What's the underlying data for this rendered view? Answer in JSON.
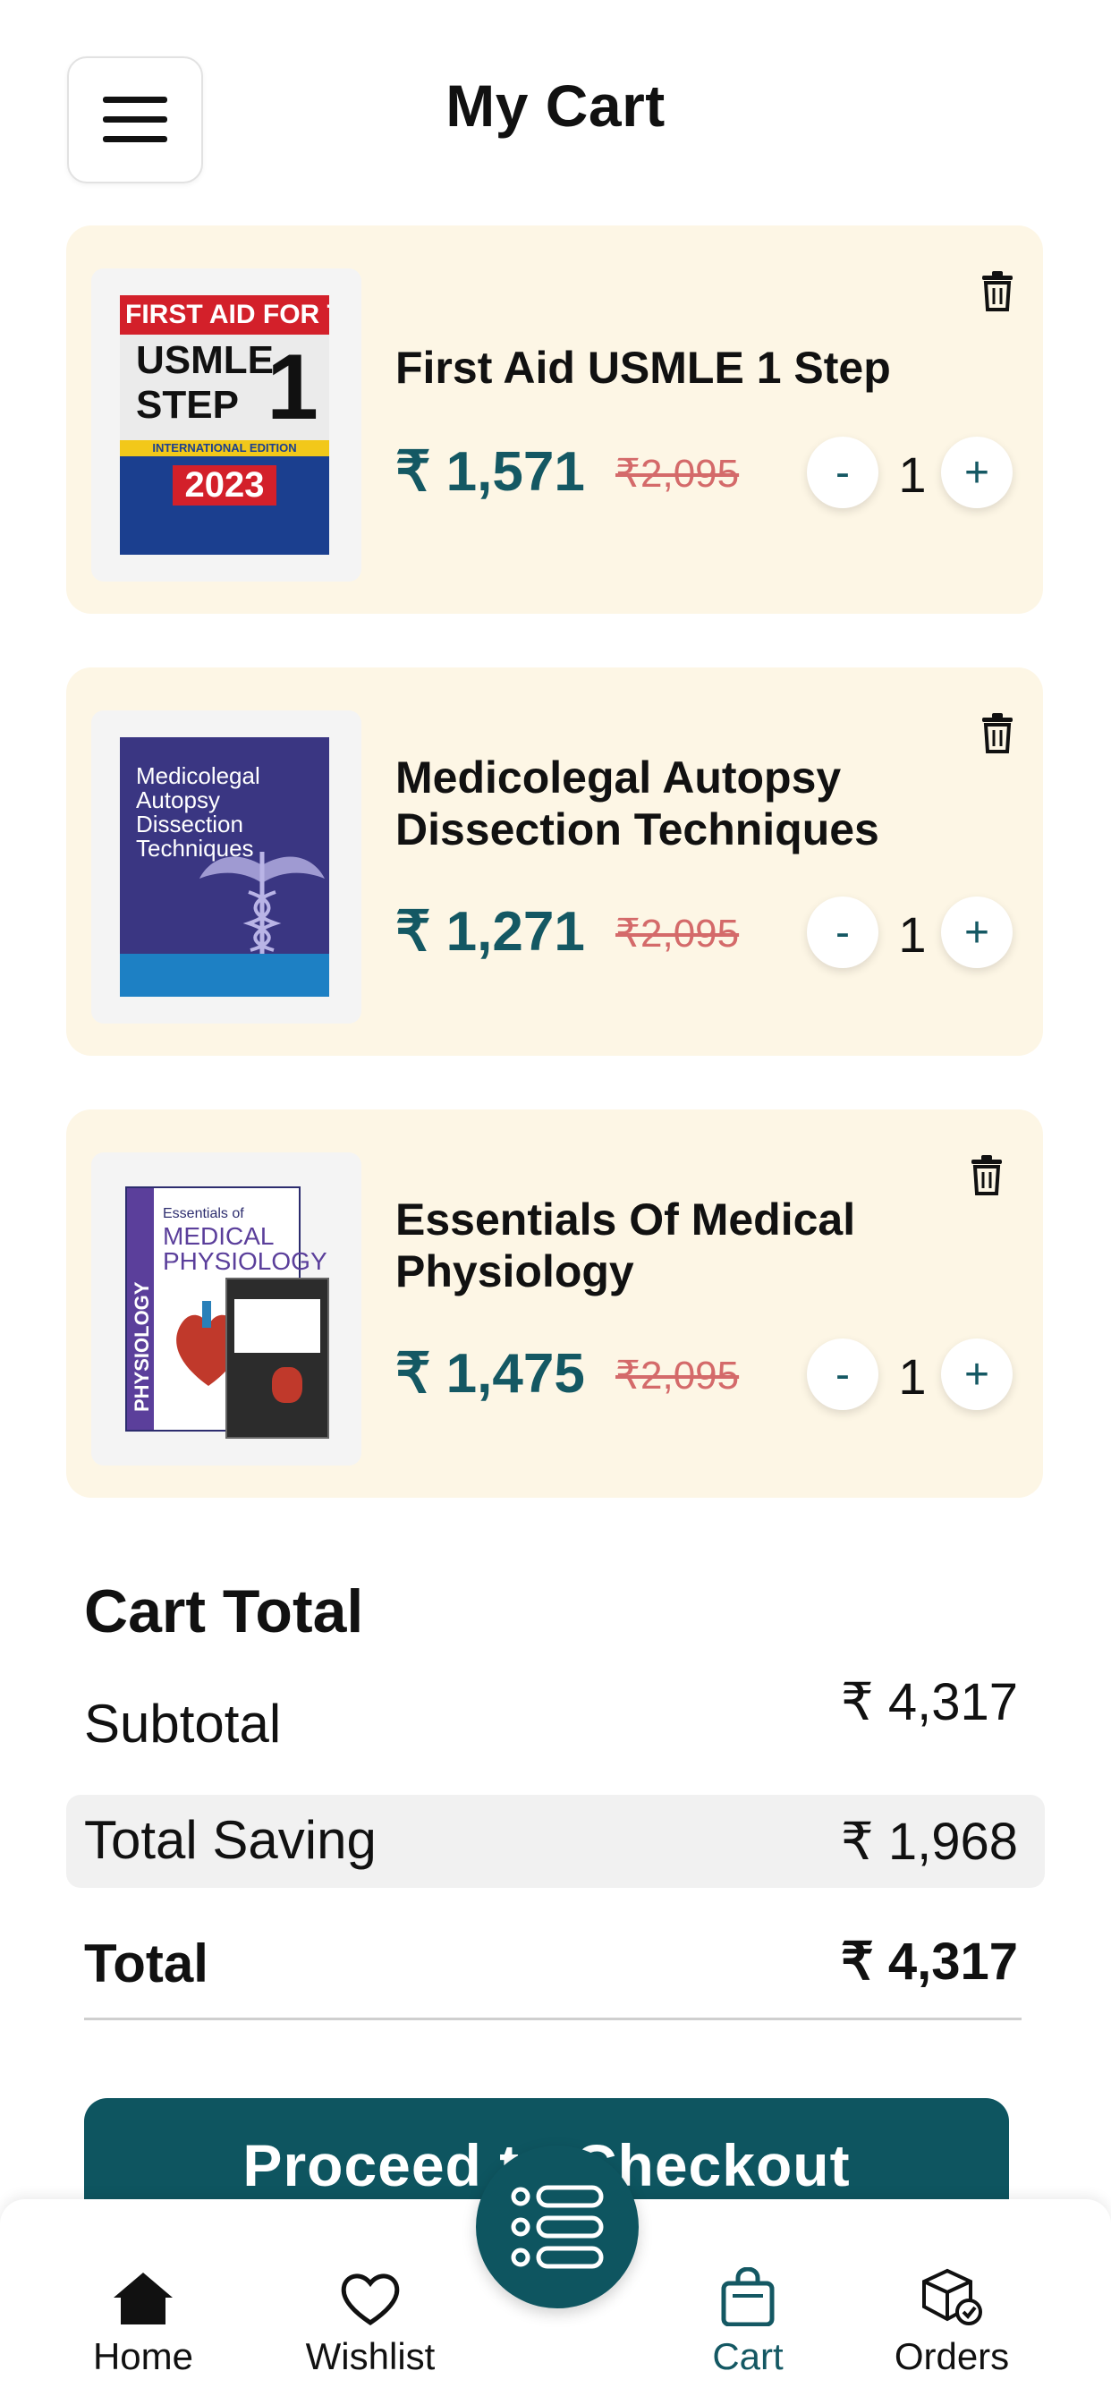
{
  "header": {
    "title": "My Cart",
    "menu_icon": "hamburger-menu-icon"
  },
  "cart": {
    "items": [
      {
        "title": "First Aid USMLE 1 Step",
        "price": "₹ 1,571",
        "mrp": "₹2,095",
        "quantity": "1",
        "minus": "-",
        "plus": "+",
        "cover": {
          "line1": "FIRST AID FOR THE®",
          "line2": "USMLE",
          "line3": "STEP",
          "step_no": "1",
          "edition": "INTERNATIONAL EDITION",
          "year": "2023"
        }
      },
      {
        "title_line1": "Medicolegal Autopsy",
        "title_line2": "Dissection Techniques",
        "price": "₹ 1,271",
        "mrp": "₹2,095",
        "quantity": "1",
        "minus": "-",
        "plus": "+",
        "cover": {
          "line1": "Medicolegal",
          "line2": "Autopsy",
          "line3": "Dissection",
          "line4": "Techniques"
        }
      },
      {
        "title_line1": "Essentials Of Medical",
        "title_line2": "Physiology",
        "price": "₹ 1,475",
        "mrp": "₹2,095",
        "quantity": "1",
        "minus": "-",
        "plus": "+",
        "cover": {
          "side": "PHYSIOLOGY",
          "line1": "Essentials of",
          "line2": "MEDICAL",
          "line3": "PHYSIOLOGY"
        }
      }
    ]
  },
  "totals": {
    "heading": "Cart Total",
    "subtotal_label": "Subtotal",
    "subtotal_value": "₹ 4,317",
    "saving_label": "Total Saving",
    "saving_value": "₹ 1,968",
    "total_label": "Total",
    "total_value": "₹ 4,317"
  },
  "checkout": {
    "label": "Proceed to Checkout"
  },
  "nav": {
    "items": [
      {
        "label": "Home",
        "icon": "home-icon"
      },
      {
        "label": "Wishlist",
        "icon": "heart-icon"
      },
      {
        "label": "Cart",
        "icon": "bag-icon",
        "active": true
      },
      {
        "label": "Orders",
        "icon": "box-icon"
      }
    ],
    "fab_icon": "list-icon"
  },
  "colors": {
    "primary": "#0e5560",
    "price": "#145863",
    "card_bg": "#fdf6e5",
    "strike": "#d46a6a"
  }
}
